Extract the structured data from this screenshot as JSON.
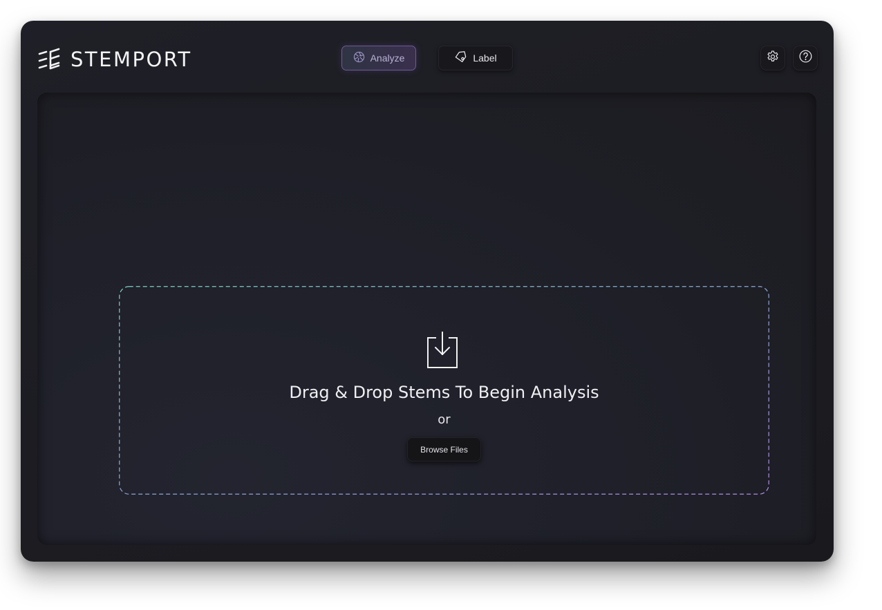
{
  "app": {
    "logo_text": "STEMPORT"
  },
  "tabs": [
    {
      "label": "Analyze",
      "icon": "aperture-icon",
      "active": true
    },
    {
      "label": "Label",
      "icon": "tag-icon",
      "active": false
    }
  ],
  "header_actions": [
    {
      "icon": "gear-icon"
    },
    {
      "icon": "help-circle-icon"
    }
  ],
  "dropzone": {
    "icon": "download-into-tray-icon",
    "title": "Drag & Drop Stems To Begin Analysis",
    "or_text": "or",
    "browse_label": "Browse Files"
  },
  "colors": {
    "background": "#1e1f26",
    "accent_teal": "#6fc3b8",
    "accent_purple": "#a07fd8",
    "text": "#f0f0f3"
  }
}
